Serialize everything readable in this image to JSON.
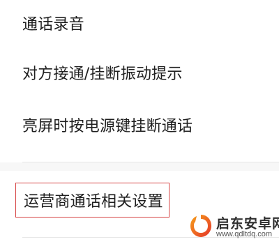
{
  "settings": {
    "items": [
      {
        "label": "通话录音"
      },
      {
        "label": "对方接通/挂断振动提示"
      },
      {
        "label": "亮屏时按电源键挂断通话"
      },
      {
        "label": "运营商通话相关设置"
      }
    ],
    "highlight_color": "#d64545"
  },
  "watermark": {
    "title": "启东安卓网",
    "url": "www.qdltdq.com",
    "logo_colors": [
      "#f6a21a",
      "#e5332a"
    ]
  }
}
